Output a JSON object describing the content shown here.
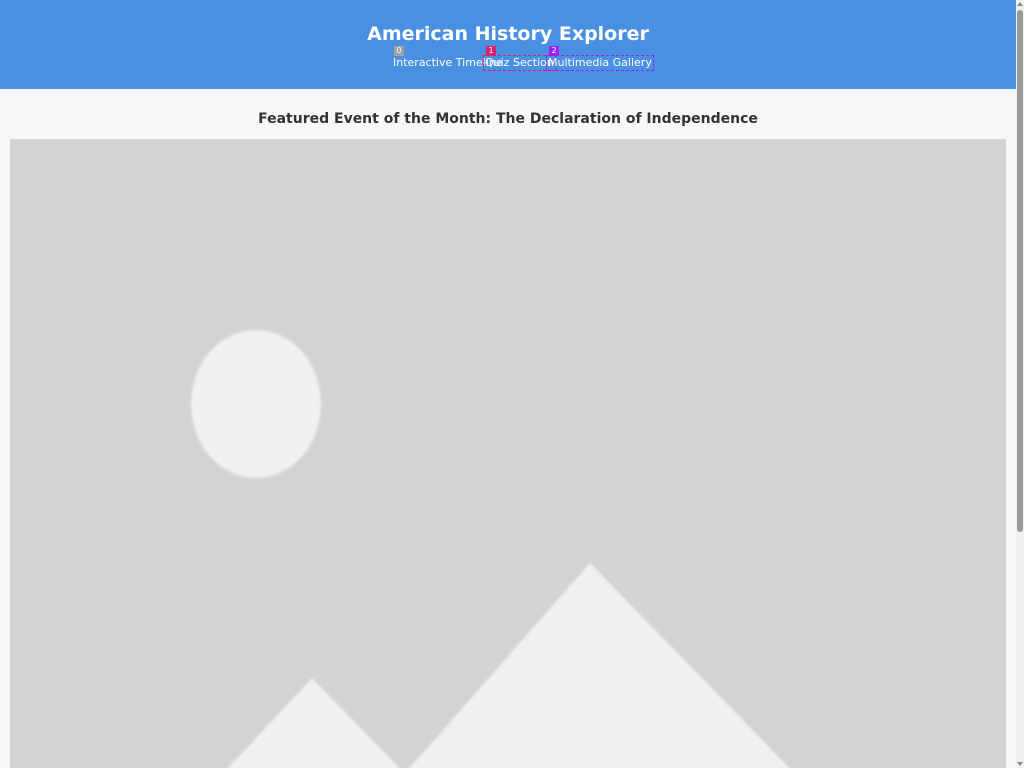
{
  "header": {
    "title": "American History Explorer",
    "background_color": "#4a90e2",
    "nav": [
      {
        "badge": "0",
        "badge_color": "#a0a0a0",
        "label": "Interactive Timeline"
      },
      {
        "badge": "1",
        "badge_color": "#d6246e",
        "label": "Quiz Section"
      },
      {
        "badge": "2",
        "badge_color": "#a020f0",
        "label": "Multimedia Gallery"
      }
    ]
  },
  "featured": {
    "title": "Featured Event of the Month: The Declaration of Independence",
    "image_icon": "image-placeholder-icon"
  }
}
